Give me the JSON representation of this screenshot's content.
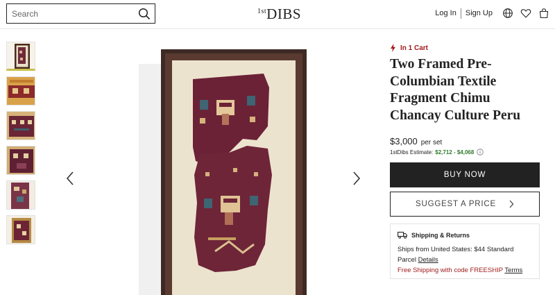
{
  "header": {
    "search_placeholder": "Search",
    "logo_text": "DIBS",
    "logo_superscript": "1st",
    "login_label": "Log In",
    "signup_label": "Sign Up",
    "icons": [
      "search-icon",
      "globe-icon",
      "heart-icon",
      "bag-icon"
    ]
  },
  "gallery": {
    "thumbnail_count": 6,
    "active_thumbnail": 1
  },
  "product": {
    "cart_status": "In 1 Cart",
    "title": "Two Framed Pre-Columbian Textile Fragment Chimu Chancay Culture Peru",
    "price": "$3,000",
    "price_unit": "per set",
    "estimate_label": "1stDibs Estimate:",
    "estimate_value": "$2,712 - $4,068",
    "buy_now_label": "BUY NOW",
    "suggest_price_label": "SUGGEST A PRICE"
  },
  "shipping": {
    "heading": "Shipping & Returns",
    "ships_from": "Ships from United States: $44 Standard Parcel",
    "details_link": "Details",
    "free_shipping": "Free Shipping with code FREESHIP",
    "terms_link": "Terms"
  },
  "colors": {
    "accent_red": "#a11c1c",
    "button_dark": "#222222",
    "estimate_green": "#2f7a2f"
  }
}
